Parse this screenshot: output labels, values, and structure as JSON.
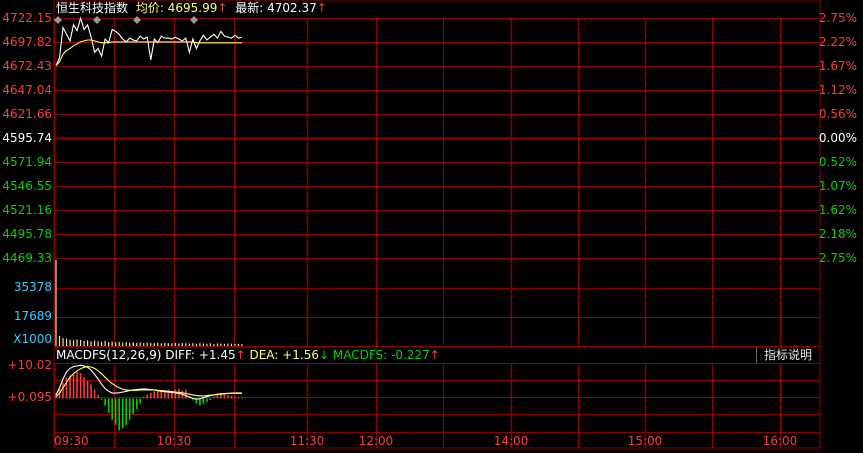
{
  "header": {
    "index_name": "恒生科技指数",
    "avg_label": "均价:",
    "avg_value": "4695.99",
    "avg_arrow": "↑",
    "last_label": "最新:",
    "last_value": "4702.37",
    "last_arrow": "↑"
  },
  "macd_header": {
    "name": "MACDFS(12,26,9)",
    "diff_label": "DIFF:",
    "diff_value": "+1.45",
    "diff_arrow": "↑",
    "dea_label": "DEA:",
    "dea_value": "+1.56",
    "dea_arrow": "↓",
    "macdfs_label": "MACDFS:",
    "macdfs_value": "-0.227",
    "macdfs_arrow": "↑"
  },
  "help_button": {
    "label": "指标说明"
  },
  "colors": {
    "grid": "#8b0000",
    "up": "#ff3b3b",
    "down": "#00d400",
    "neutral": "#ffffff",
    "price_line": "#ffffff",
    "avg_line": "#ffff66",
    "volume": "#e8e8a0",
    "volume_axis": "#33ccff",
    "dea_line": "#ffff66"
  },
  "chart_data": [
    {
      "type": "line",
      "x_ticks": [
        "09:30",
        "10:30",
        "11:30",
        "12:00",
        "14:00",
        "15:00",
        "16:00"
      ],
      "y_left_ticks": [
        "4722.15",
        "4697.82",
        "4672.43",
        "4647.04",
        "4621.66",
        "4595.74",
        "4571.94",
        "4546.55",
        "4521.16",
        "4495.78",
        "4469.33"
      ],
      "y_right_ticks": [
        "2.75%",
        "2.22%",
        "1.67%",
        "1.12%",
        "0.56%",
        "0.00%",
        "0.52%",
        "1.07%",
        "1.62%",
        "2.18%",
        "2.75%"
      ],
      "prev_close": 4595.74,
      "ylim": [
        4469.33,
        4722.15
      ],
      "series": [
        {
          "values": [
            4672,
            4680,
            4712,
            4705,
            4698,
            4715,
            4709,
            4722,
            4710,
            4715,
            4702,
            4686,
            4690,
            4682,
            4700,
            4696,
            4710,
            4708,
            4705,
            4700,
            4697,
            4701,
            4699,
            4698,
            4703,
            4700,
            4702,
            4678,
            4700,
            4696,
            4703,
            4701,
            4701,
            4700,
            4702,
            4700,
            4698,
            4701,
            4686,
            4700,
            4690,
            4698,
            4704,
            4699,
            4702,
            4705,
            4701,
            4708,
            4703,
            4702,
            4701,
            4704,
            4701,
            4702
          ]
        },
        {
          "values": [
            4672,
            4676,
            4684,
            4688,
            4690,
            4693,
            4695,
            4697,
            4698,
            4699,
            4699,
            4698,
            4697,
            4696,
            4696,
            4696,
            4697,
            4697,
            4697,
            4697,
            4697,
            4697,
            4697,
            4697,
            4697,
            4697,
            4697,
            4697,
            4697,
            4697,
            4697,
            4697,
            4697,
            4697,
            4697,
            4697,
            4697,
            4697,
            4697,
            4697,
            4696,
            4696,
            4696,
            4696,
            4696,
            4696,
            4696,
            4696,
            4696,
            4696,
            4696,
            4696,
            4696,
            4696
          ]
        }
      ]
    },
    {
      "type": "bar",
      "y_ticks": [
        "35378",
        "17689"
      ],
      "unit_label": "X1000",
      "ylim": [
        0,
        44000
      ],
      "values": [
        44000,
        5200,
        4100,
        3700,
        3300,
        2900,
        3400,
        3100,
        2600,
        2900,
        2500,
        2800,
        2400,
        2200,
        2600,
        2000,
        2300,
        1900,
        2100,
        1800,
        2000,
        1700,
        1900,
        1600,
        1800,
        1500,
        1700,
        1600,
        1500,
        1700,
        1400,
        1600,
        1500,
        1400,
        1600,
        1300,
        1500,
        1400,
        1300,
        1500,
        1200,
        1400,
        1300,
        1200,
        1400,
        1100,
        1300,
        1200,
        1100,
        1300,
        1200,
        1100,
        1200,
        1000
      ]
    },
    {
      "type": "bar",
      "y_ticks": [
        "+10.02",
        "+0.095"
      ],
      "zero_value": 0.095,
      "ylim": [
        -9.5,
        10.02
      ],
      "histogram": [
        1.5,
        3,
        4.5,
        6,
        6.5,
        7,
        7.5,
        7.2,
        6,
        5,
        4,
        2.5,
        1,
        -0.5,
        -2,
        -4,
        -6,
        -7.5,
        -9,
        -8.5,
        -7.5,
        -6,
        -4.5,
        -3,
        -1.5,
        0.5,
        1,
        1.5,
        2,
        2.2,
        2,
        2.4,
        2.6,
        2.2,
        2.5,
        2.8,
        2.2,
        2.5,
        0.5,
        -0.5,
        -1.5,
        -2,
        -1.5,
        -1,
        -0.5,
        0.5,
        1,
        1.5,
        1.2,
        1,
        0.8,
        0.5,
        0.3,
        -0.2
      ],
      "series": [
        {
          "name": "DIFF",
          "values": [
            1,
            3,
            5.5,
            7.5,
            8.5,
            9,
            9.2,
            9.4,
            9.2,
            8.8,
            8,
            6.8,
            5.5,
            4,
            2.8,
            2,
            1.5,
            1.5,
            1.6,
            1.8,
            2,
            2.2,
            2.4,
            2.5,
            2.6,
            2.7,
            2.6,
            2.5,
            2.4,
            2.2,
            2,
            1.9,
            1.8,
            1.7,
            1.6,
            1.4,
            1.2,
            0.8,
            0.4,
            0,
            -0.2,
            -0.1,
            0.2,
            0.5,
            0.8,
            1,
            1.2,
            1.3,
            1.4,
            1.45,
            1.45,
            1.45,
            1.45,
            1.45
          ]
        },
        {
          "name": "DEA",
          "values": [
            0.5,
            1.5,
            3,
            4.5,
            6,
            7,
            7.8,
            8.4,
            8.8,
            9,
            8.9,
            8.5,
            7.8,
            7,
            6,
            5,
            4.2,
            3.5,
            3,
            2.6,
            2.4,
            2.3,
            2.3,
            2.3,
            2.4,
            2.4,
            2.4,
            2.4,
            2.4,
            2.3,
            2.2,
            2.1,
            2,
            1.9,
            1.8,
            1.7,
            1.6,
            1.4,
            1.2,
            1,
            0.8,
            0.7,
            0.7,
            0.8,
            0.9,
            1,
            1.1,
            1.2,
            1.3,
            1.4,
            1.5,
            1.55,
            1.56,
            1.56
          ]
        }
      ]
    }
  ]
}
